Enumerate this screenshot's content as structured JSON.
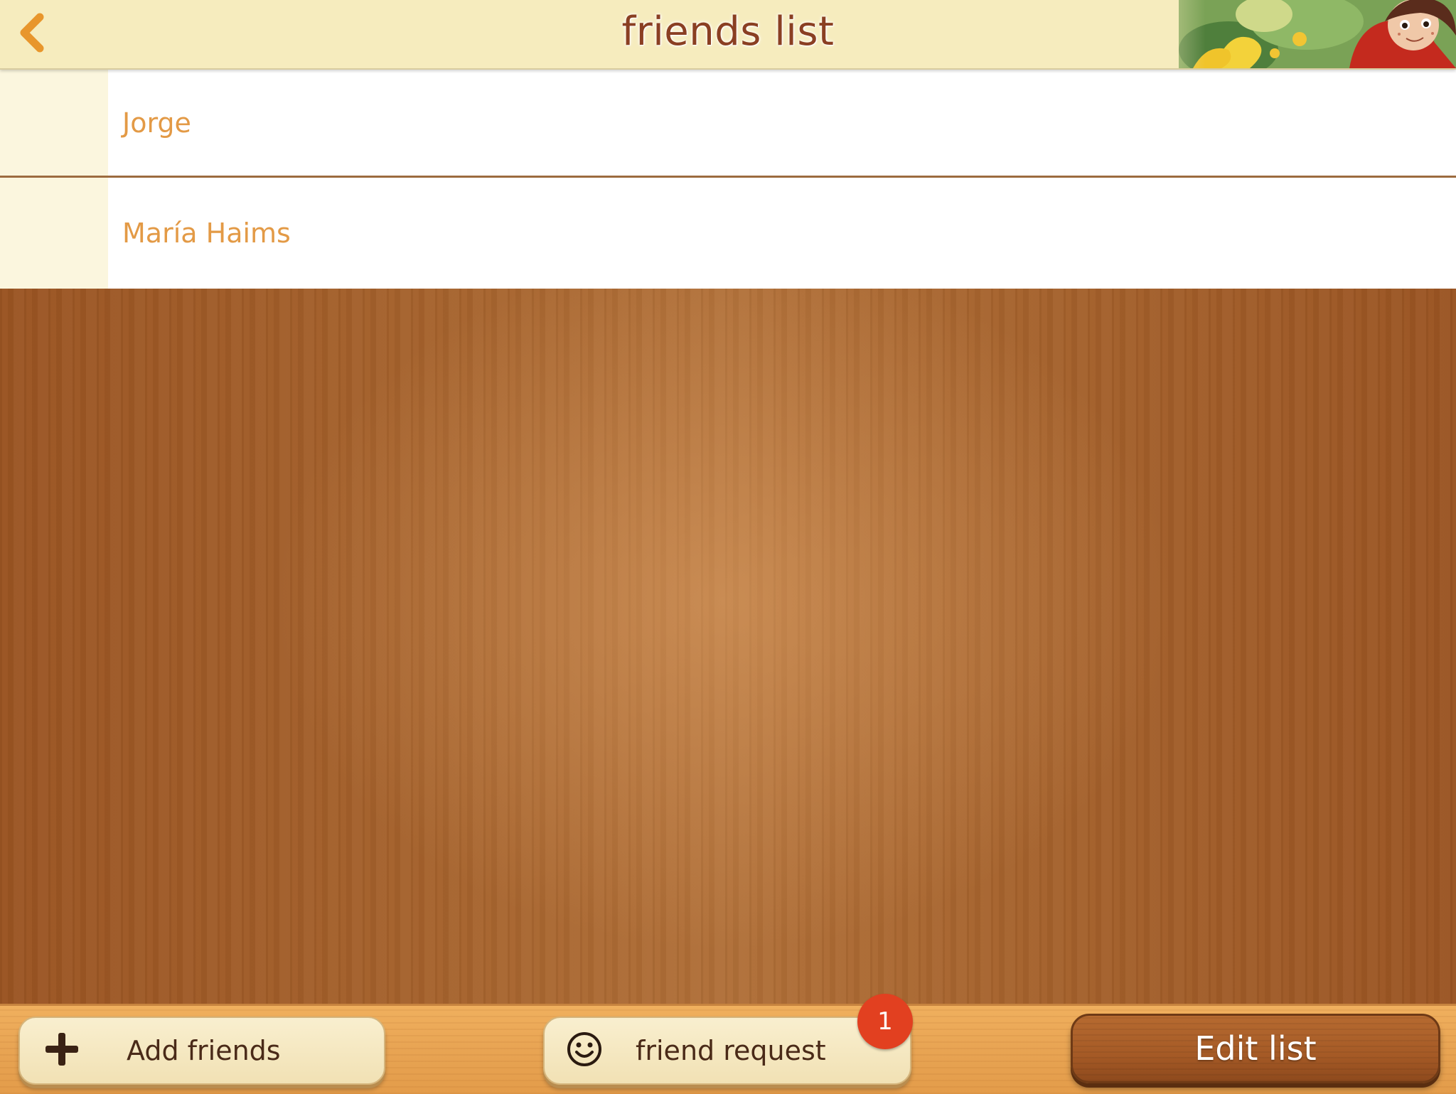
{
  "header": {
    "title": "friends list",
    "back_icon": "chevron-left-icon",
    "accent_color": "#e8962c",
    "title_color": "#8a3f22"
  },
  "friends": [
    {
      "name": "Jorge"
    },
    {
      "name": "María Haims"
    }
  ],
  "toolbar": {
    "add_label": "Add friends",
    "add_icon": "plus-icon",
    "request_label": "friend request",
    "request_icon": "smiley-icon",
    "request_badge": "1",
    "edit_label": "Edit list"
  },
  "colors": {
    "name_text": "#e39a46",
    "badge": "#e24020",
    "wood": "#a5622c"
  }
}
